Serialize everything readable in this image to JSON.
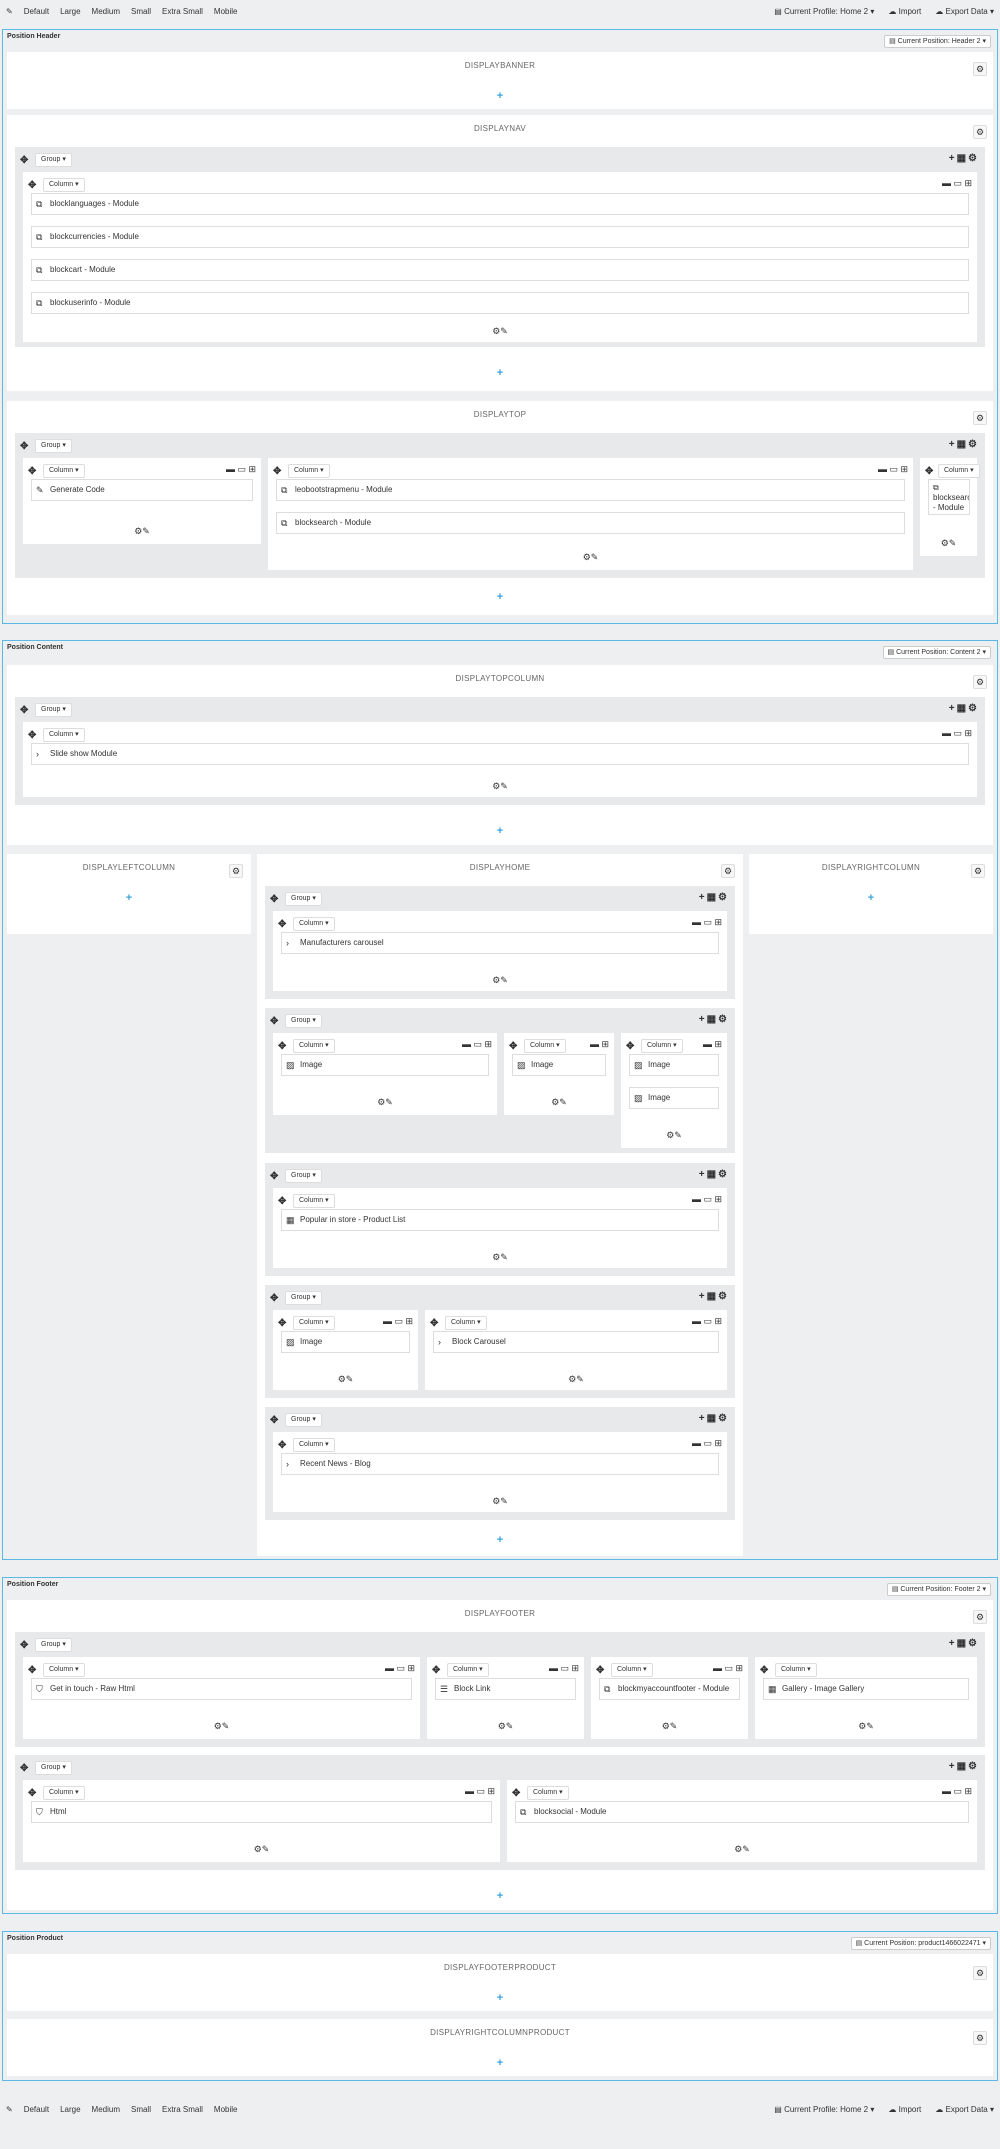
{
  "toolbar": {
    "items": [
      "Default",
      "Large",
      "Medium",
      "Small",
      "Extra Small",
      "Mobile"
    ],
    "profile": "Current Profile: Home 2",
    "import": "Import",
    "export": "Export Data"
  },
  "header": {
    "title": "Position Header",
    "selector": "Current Position: Header 2",
    "displaybanner": "DISPLAYBANNER",
    "displaynav": "DISPLAYNAV",
    "displaytop": "DISPLAYTOP",
    "nav_modules": [
      "blocklanguages - Module",
      "blockcurrencies - Module",
      "blockcart - Module",
      "blockuserinfo - Module"
    ],
    "top_col1": "Generate Code",
    "top_col2": [
      "leobootstrapmenu - Module",
      "blocksearch - Module"
    ],
    "top_col3": "blocksearch - Module"
  },
  "content": {
    "title": "Position Content",
    "selector": "Current Position: Content 2",
    "displaytopcolumn": "DISPLAYTOPCOLUMN",
    "displayleftcolumn": "DISPLAYLEFTCOLUMN",
    "displayhome": "DISPLAYHOME",
    "displayrightcolumn": "DISPLAYRIGHTCOLUMN",
    "slideshow": "Slide show Module",
    "manufacturers": "Manufacturers carousel",
    "image": "Image",
    "popular": "Popular in store - Product List",
    "block_carousel": "Block Carousel",
    "recent_news": "Recent News - Blog"
  },
  "footer": {
    "title": "Position Footer",
    "selector": "Current Position: Footer 2",
    "displayfooter": "DISPLAYFOOTER",
    "get_in_touch": "Get in touch - Raw Html",
    "block_link": "Block Link",
    "blockmyaccountfooter": "blockmyaccountfooter - Module",
    "gallery": "Gallery - Image Gallery",
    "html": "Html",
    "blocksocial": "blocksocial - Module"
  },
  "product": {
    "title": "Position Product",
    "selector": "Current Position: product1466022471",
    "displayfooterproduct": "DISPLAYFOOTERPRODUCT",
    "displayrightcolumnproduct": "DISPLAYRIGHTCOLUMNPRODUCT"
  },
  "labels": {
    "group": "Group ▾",
    "column": "Column ▾"
  }
}
